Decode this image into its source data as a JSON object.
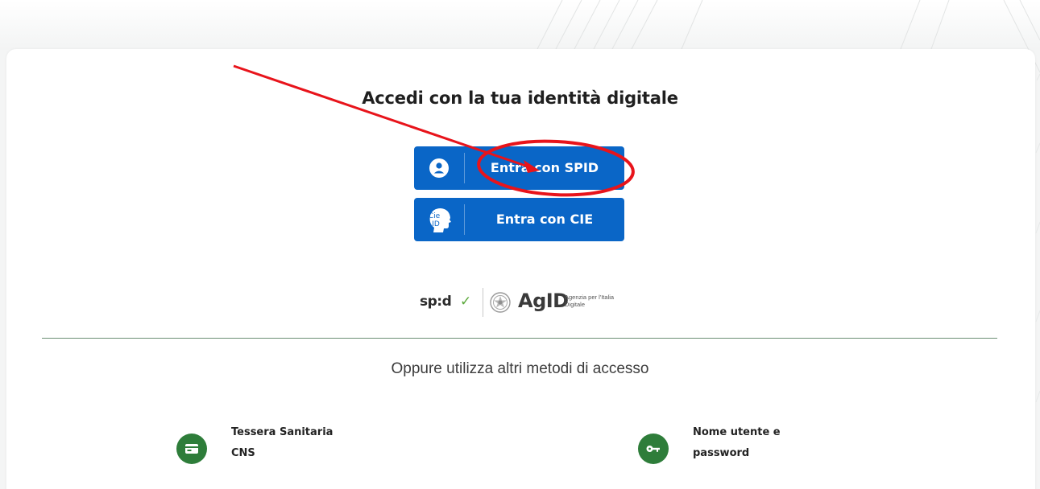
{
  "login": {
    "title": "Accedi con la tua identità digitale",
    "spid_button_label": "Entra con SPID",
    "cie_button_label": "Entra con CIE",
    "cie_icon_text_top": "Cie",
    "cie_icon_text_bottom": "ID"
  },
  "logos": {
    "spid": "sp:d",
    "spid_check": "✓",
    "agid": "AgID",
    "agid_subtitle": "Agenzia per l'Italia Digitale"
  },
  "alternatives": {
    "heading": "Oppure utilizza altri metodi di accesso",
    "methods": [
      {
        "line1": "Tessera Sanitaria",
        "line2": "CNS",
        "icon": "card-icon"
      },
      {
        "line1": "Nome utente e",
        "line2": "password",
        "icon": "key-icon"
      }
    ]
  },
  "colors": {
    "primary_button": "#0a66c7",
    "method_icon_bg": "#2e7d3a",
    "annotation": "#e8141b",
    "divider": "#6b8f74"
  }
}
